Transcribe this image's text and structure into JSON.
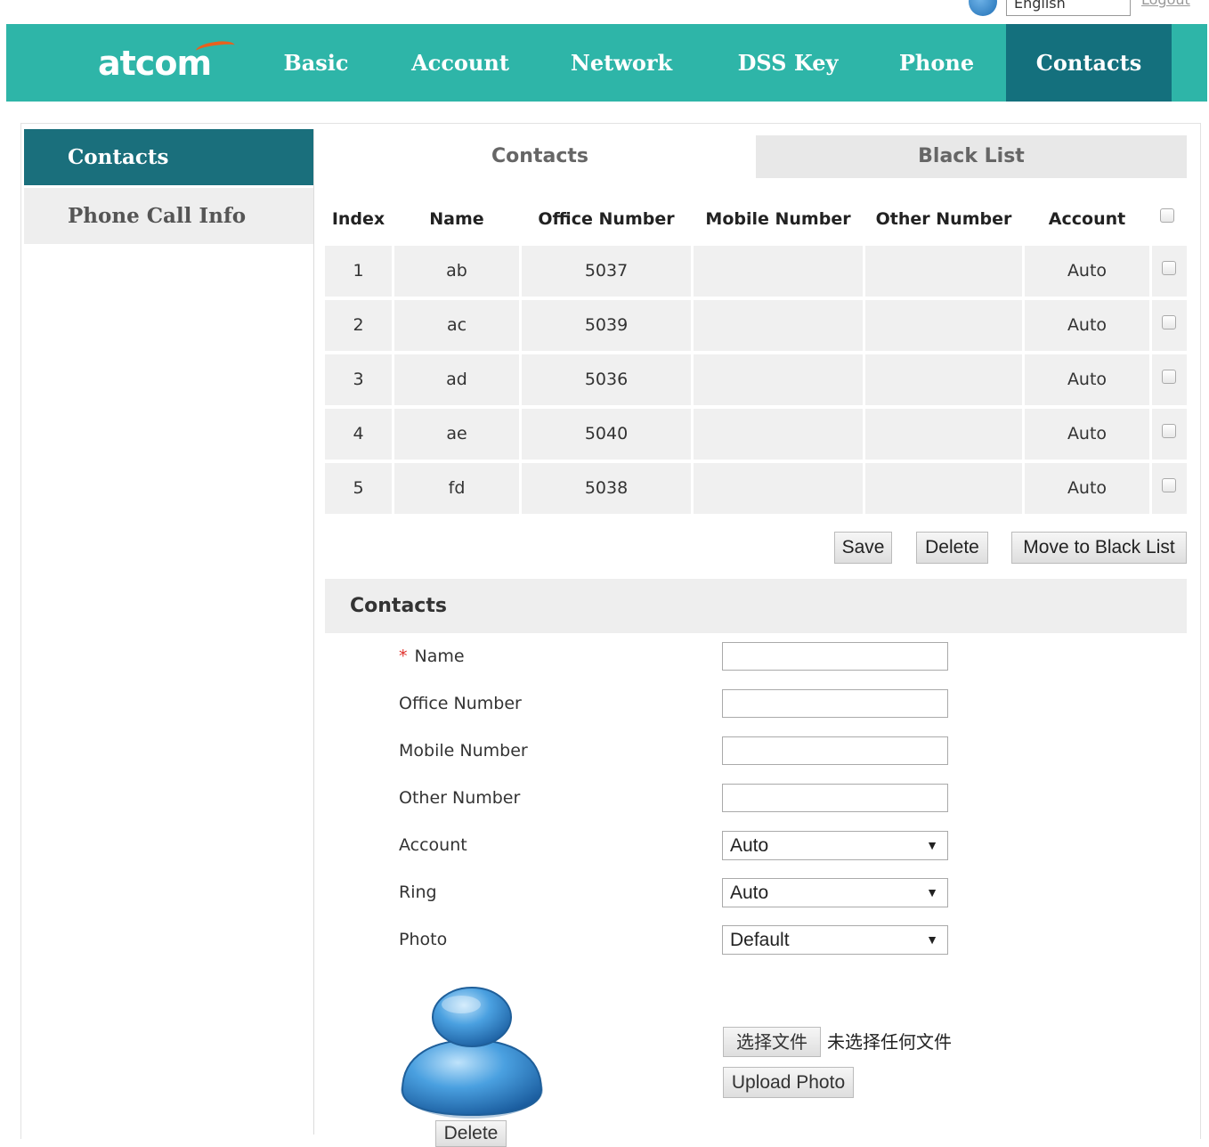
{
  "utility": {
    "language": "English",
    "logout": "Logout"
  },
  "brand": {
    "logo": "atcom"
  },
  "nav": [
    "Basic",
    "Account",
    "Network",
    "DSS Key",
    "Phone",
    "Contacts"
  ],
  "sidebar": {
    "items": [
      "Contacts",
      "Phone Call Info"
    ]
  },
  "tabs": [
    "Contacts",
    "Black List"
  ],
  "table": {
    "headers": [
      "Index",
      "Name",
      "Office Number",
      "Mobile Number",
      "Other Number",
      "Account"
    ],
    "rows": [
      {
        "index": "1",
        "name": "ab",
        "office": "5037",
        "mobile": "",
        "other": "",
        "account": "Auto"
      },
      {
        "index": "2",
        "name": "ac",
        "office": "5039",
        "mobile": "",
        "other": "",
        "account": "Auto"
      },
      {
        "index": "3",
        "name": "ad",
        "office": "5036",
        "mobile": "",
        "other": "",
        "account": "Auto"
      },
      {
        "index": "4",
        "name": "ae",
        "office": "5040",
        "mobile": "",
        "other": "",
        "account": "Auto"
      },
      {
        "index": "5",
        "name": "fd",
        "office": "5038",
        "mobile": "",
        "other": "",
        "account": "Auto"
      }
    ]
  },
  "actions": {
    "save": "Save",
    "delete": "Delete",
    "move_to_black_list": "Move to Black List"
  },
  "form": {
    "title": "Contacts",
    "required_mark": "*",
    "labels": {
      "name": "Name",
      "office": "Office Number",
      "mobile": "Mobile Number",
      "other": "Other Number",
      "account": "Account",
      "ring": "Ring",
      "photo": "Photo"
    },
    "values": {
      "account": "Auto",
      "ring": "Auto",
      "photo": "Default"
    },
    "choose_file": "选择文件",
    "no_file": "未选择任何文件",
    "upload_photo": "Upload Photo",
    "delete_photo": "Delete"
  },
  "colors": {
    "header": "#2eb5a8",
    "active_nav": "#14707d",
    "sidebar_active": "#1a6f7c",
    "required": "#e0302b"
  }
}
